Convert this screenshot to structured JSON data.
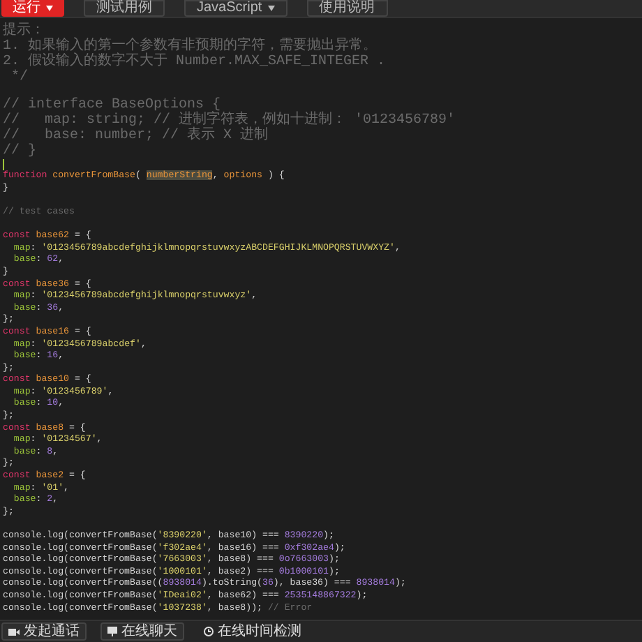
{
  "toolbar": {
    "buttons": [
      {
        "label": "运行",
        "kind": "primary"
      },
      {
        "label": "测试用例",
        "kind": "plain"
      },
      {
        "label": "JavaScript",
        "kind": "dropdown"
      },
      {
        "label": "使用说明",
        "kind": "plain"
      }
    ]
  },
  "code_lines": [
    {
      "kind": "comment",
      "tokens": [
        {
          "kind": "comment",
          "text": "提示："
        }
      ]
    },
    {
      "kind": "comment",
      "tokens": [
        {
          "kind": "comment",
          "text": "1. 如果输入的第一个参数有非预期的字符，需要抛出异常。"
        }
      ]
    },
    {
      "kind": "comment",
      "tokens": [
        {
          "kind": "comment",
          "text": "2. 假设输入的数字不大于 Number.MAX_SAFE_INTEGER ."
        }
      ]
    },
    {
      "kind": "comment",
      "tokens": [
        {
          "kind": "comment",
          "text": " */"
        }
      ]
    },
    {
      "kind": "blank"
    },
    {
      "kind": "comment",
      "tokens": [
        {
          "kind": "comment",
          "text": "// interface BaseOptions {"
        }
      ]
    },
    {
      "kind": "comment",
      "tokens": [
        {
          "kind": "comment",
          "text": "//   map: string; // 进制字符表，例如十进制： '0123456789'"
        }
      ]
    },
    {
      "kind": "comment",
      "tokens": [
        {
          "kind": "comment",
          "text": "//   base: number; // 表示 X 进制"
        }
      ]
    },
    {
      "kind": "comment",
      "tokens": [
        {
          "kind": "comment",
          "text": "// }"
        }
      ]
    },
    {
      "kind": "cursor"
    },
    {
      "kind": "code",
      "tokens": [
        {
          "kind": "keyword",
          "text": "function"
        },
        {
          "kind": "name",
          "text": " convertFromBase"
        },
        {
          "kind": "plain",
          "text": "( "
        },
        {
          "kind": "highlight",
          "text": "numberString"
        },
        {
          "kind": "plain",
          "text": ", "
        },
        {
          "kind": "name",
          "text": "options"
        },
        {
          "kind": "plain",
          "text": " ) {"
        }
      ]
    },
    {
      "kind": "code",
      "tokens": [
        {
          "kind": "plain",
          "text": "}"
        }
      ]
    },
    {
      "kind": "blank"
    },
    {
      "kind": "code",
      "tokens": [
        {
          "kind": "comment",
          "text": "// test cases"
        }
      ]
    },
    {
      "kind": "blank"
    },
    {
      "kind": "code",
      "tokens": [
        {
          "kind": "keyword",
          "text": "const"
        },
        {
          "kind": "name",
          "text": " base62"
        },
        {
          "kind": "plain",
          "text": " = {"
        }
      ]
    },
    {
      "kind": "code",
      "tokens": [
        {
          "kind": "prop",
          "text": "  map"
        },
        {
          "kind": "plain",
          "text": ": "
        },
        {
          "kind": "string",
          "text": "'0123456789abcdefghijklmnopqrstuvwxyzABCDEFGHIJKLMNOPQRSTUVWXYZ'"
        },
        {
          "kind": "plain",
          "text": ","
        }
      ]
    },
    {
      "kind": "code",
      "tokens": [
        {
          "kind": "prop",
          "text": "  base"
        },
        {
          "kind": "plain",
          "text": ": "
        },
        {
          "kind": "number",
          "text": "62"
        },
        {
          "kind": "plain",
          "text": ","
        }
      ]
    },
    {
      "kind": "code",
      "tokens": [
        {
          "kind": "plain",
          "text": "}"
        }
      ]
    },
    {
      "kind": "code",
      "tokens": [
        {
          "kind": "keyword",
          "text": "const"
        },
        {
          "kind": "name",
          "text": " base36"
        },
        {
          "kind": "plain",
          "text": " = {"
        }
      ]
    },
    {
      "kind": "code",
      "tokens": [
        {
          "kind": "prop",
          "text": "  map"
        },
        {
          "kind": "plain",
          "text": ": "
        },
        {
          "kind": "string",
          "text": "'0123456789abcdefghijklmnopqrstuvwxyz'"
        },
        {
          "kind": "plain",
          "text": ","
        }
      ]
    },
    {
      "kind": "code",
      "tokens": [
        {
          "kind": "prop",
          "text": "  base"
        },
        {
          "kind": "plain",
          "text": ": "
        },
        {
          "kind": "number",
          "text": "36"
        },
        {
          "kind": "plain",
          "text": ","
        }
      ]
    },
    {
      "kind": "code",
      "tokens": [
        {
          "kind": "plain",
          "text": "};"
        }
      ]
    },
    {
      "kind": "code",
      "tokens": [
        {
          "kind": "keyword",
          "text": "const"
        },
        {
          "kind": "name",
          "text": " base16"
        },
        {
          "kind": "plain",
          "text": " = {"
        }
      ]
    },
    {
      "kind": "code",
      "tokens": [
        {
          "kind": "prop",
          "text": "  map"
        },
        {
          "kind": "plain",
          "text": ": "
        },
        {
          "kind": "string",
          "text": "'0123456789abcdef'"
        },
        {
          "kind": "plain",
          "text": ","
        }
      ]
    },
    {
      "kind": "code",
      "tokens": [
        {
          "kind": "prop",
          "text": "  base"
        },
        {
          "kind": "plain",
          "text": ": "
        },
        {
          "kind": "number",
          "text": "16"
        },
        {
          "kind": "plain",
          "text": ","
        }
      ]
    },
    {
      "kind": "code",
      "tokens": [
        {
          "kind": "plain",
          "text": "};"
        }
      ]
    },
    {
      "kind": "code",
      "tokens": [
        {
          "kind": "keyword",
          "text": "const"
        },
        {
          "kind": "name",
          "text": " base10"
        },
        {
          "kind": "plain",
          "text": " = {"
        }
      ]
    },
    {
      "kind": "code",
      "tokens": [
        {
          "kind": "prop",
          "text": "  map"
        },
        {
          "kind": "plain",
          "text": ": "
        },
        {
          "kind": "string",
          "text": "'0123456789'"
        },
        {
          "kind": "plain",
          "text": ","
        }
      ]
    },
    {
      "kind": "code",
      "tokens": [
        {
          "kind": "prop",
          "text": "  base"
        },
        {
          "kind": "plain",
          "text": ": "
        },
        {
          "kind": "number",
          "text": "10"
        },
        {
          "kind": "plain",
          "text": ","
        }
      ]
    },
    {
      "kind": "code",
      "tokens": [
        {
          "kind": "plain",
          "text": "};"
        }
      ]
    },
    {
      "kind": "code",
      "tokens": [
        {
          "kind": "keyword",
          "text": "const"
        },
        {
          "kind": "name",
          "text": " base8"
        },
        {
          "kind": "plain",
          "text": " = {"
        }
      ]
    },
    {
      "kind": "code",
      "tokens": [
        {
          "kind": "prop",
          "text": "  map"
        },
        {
          "kind": "plain",
          "text": ": "
        },
        {
          "kind": "string",
          "text": "'01234567'"
        },
        {
          "kind": "plain",
          "text": ","
        }
      ]
    },
    {
      "kind": "code",
      "tokens": [
        {
          "kind": "prop",
          "text": "  base"
        },
        {
          "kind": "plain",
          "text": ": "
        },
        {
          "kind": "number",
          "text": "8"
        },
        {
          "kind": "plain",
          "text": ","
        }
      ]
    },
    {
      "kind": "code",
      "tokens": [
        {
          "kind": "plain",
          "text": "};"
        }
      ]
    },
    {
      "kind": "code",
      "tokens": [
        {
          "kind": "keyword",
          "text": "const"
        },
        {
          "kind": "name",
          "text": " base2"
        },
        {
          "kind": "plain",
          "text": " = {"
        }
      ]
    },
    {
      "kind": "code",
      "tokens": [
        {
          "kind": "prop",
          "text": "  map"
        },
        {
          "kind": "plain",
          "text": ": "
        },
        {
          "kind": "string",
          "text": "'01'"
        },
        {
          "kind": "plain",
          "text": ","
        }
      ]
    },
    {
      "kind": "code",
      "tokens": [
        {
          "kind": "prop",
          "text": "  base"
        },
        {
          "kind": "plain",
          "text": ": "
        },
        {
          "kind": "number",
          "text": "2"
        },
        {
          "kind": "plain",
          "text": ","
        }
      ]
    },
    {
      "kind": "code",
      "tokens": [
        {
          "kind": "plain",
          "text": "};"
        }
      ]
    },
    {
      "kind": "blank"
    },
    {
      "kind": "code",
      "tokens": [
        {
          "kind": "plain",
          "text": "console.log(convertFromBase("
        },
        {
          "kind": "string",
          "text": "'8390220'"
        },
        {
          "kind": "plain",
          "text": ", base10) === "
        },
        {
          "kind": "number",
          "text": "8390220"
        },
        {
          "kind": "plain",
          "text": ");"
        }
      ]
    },
    {
      "kind": "code",
      "tokens": [
        {
          "kind": "plain",
          "text": "console.log(convertFromBase("
        },
        {
          "kind": "string",
          "text": "'f302ae4'"
        },
        {
          "kind": "plain",
          "text": ", base16) === "
        },
        {
          "kind": "number",
          "text": "0xf302ae4"
        },
        {
          "kind": "plain",
          "text": ");"
        }
      ]
    },
    {
      "kind": "code",
      "tokens": [
        {
          "kind": "plain",
          "text": "console.log(convertFromBase("
        },
        {
          "kind": "string",
          "text": "'7663003'"
        },
        {
          "kind": "plain",
          "text": ", base8) === "
        },
        {
          "kind": "number",
          "text": "0o7663003"
        },
        {
          "kind": "plain",
          "text": ");"
        }
      ]
    },
    {
      "kind": "code",
      "tokens": [
        {
          "kind": "plain",
          "text": "console.log(convertFromBase("
        },
        {
          "kind": "string",
          "text": "'1000101'"
        },
        {
          "kind": "plain",
          "text": ", base2) === "
        },
        {
          "kind": "number",
          "text": "0b1000101"
        },
        {
          "kind": "plain",
          "text": ");"
        }
      ]
    },
    {
      "kind": "code",
      "tokens": [
        {
          "kind": "plain",
          "text": "console.log(convertFromBase(("
        },
        {
          "kind": "number",
          "text": "8938014"
        },
        {
          "kind": "plain",
          "text": ").toString("
        },
        {
          "kind": "number",
          "text": "36"
        },
        {
          "kind": "plain",
          "text": "), base36) === "
        },
        {
          "kind": "number",
          "text": "8938014"
        },
        {
          "kind": "plain",
          "text": ");"
        }
      ]
    },
    {
      "kind": "code",
      "tokens": [
        {
          "kind": "plain",
          "text": "console.log(convertFromBase("
        },
        {
          "kind": "string",
          "text": "'IDeai02'"
        },
        {
          "kind": "plain",
          "text": ", base62) === "
        },
        {
          "kind": "number",
          "text": "2535148867322"
        },
        {
          "kind": "plain",
          "text": ");"
        }
      ]
    },
    {
      "kind": "code",
      "tokens": [
        {
          "kind": "plain",
          "text": "console.log(convertFromBase("
        },
        {
          "kind": "string",
          "text": "'1037238'"
        },
        {
          "kind": "plain",
          "text": ", base8)); "
        },
        {
          "kind": "comment",
          "text": "// Error"
        }
      ]
    }
  ],
  "footer": {
    "buttons": [
      {
        "label": "发起通话",
        "kind": "video"
      },
      {
        "label": "在线聊天",
        "kind": "chat"
      },
      {
        "label": "在线时间检测",
        "kind": "clock"
      }
    ]
  }
}
